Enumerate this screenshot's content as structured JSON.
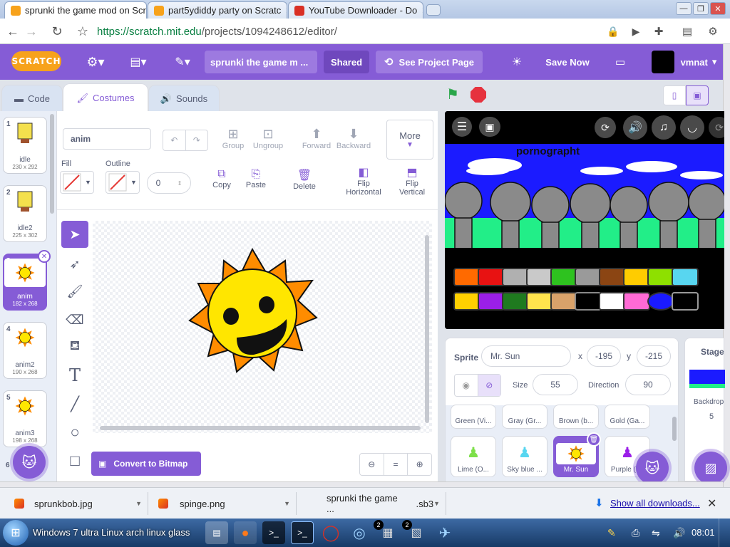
{
  "browser": {
    "tabs": [
      {
        "title": "sprunki the game mod on Scr"
      },
      {
        "title": "part5ydiddy party on Scratc"
      },
      {
        "title": "YouTube Downloader - Do"
      }
    ],
    "url_host": "https://scratch.mit.edu",
    "url_path": "/projects/1094248612/editor/"
  },
  "menubar": {
    "logo": "SCRATCH",
    "project_title": "sprunki the game m ...",
    "shared": "Shared",
    "see_project": "See Project Page",
    "save_now": "Save Now",
    "username": "vmnat"
  },
  "editor_tabs": {
    "code": "Code",
    "costumes": "Costumes",
    "sounds": "Sounds"
  },
  "costumes": [
    {
      "num": "1",
      "name": "idle",
      "size": "230 x 292"
    },
    {
      "num": "2",
      "name": "idle2",
      "size": "225 x 302"
    },
    {
      "num": "3",
      "name": "anim",
      "size": "182 x 268"
    },
    {
      "num": "4",
      "name": "anim2",
      "size": "190 x 268"
    },
    {
      "num": "5",
      "name": "anim3",
      "size": "198 x 268"
    },
    {
      "num": "6"
    }
  ],
  "paint": {
    "costume_name": "anim",
    "group": "Group",
    "ungroup": "Ungroup",
    "forward": "Forward",
    "backward": "Backward",
    "more": "More",
    "fill": "Fill",
    "outline": "Outline",
    "outline_width": "0",
    "copy": "Copy",
    "paste": "Paste",
    "delete": "Delete",
    "flip_h1": "Flip",
    "flip_h2": "Horizontal",
    "flip_v1": "Flip",
    "flip_v2": "Vertical",
    "convert": "Convert to Bitmap",
    "zoom_reset": "="
  },
  "stage": {
    "title_text": "pornographt"
  },
  "sprite_info": {
    "sprite_label": "Sprite",
    "sprite_name": "Mr. Sun",
    "x_label": "x",
    "x": "-195",
    "y_label": "y",
    "y": "-215",
    "size_label": "Size",
    "size": "55",
    "direction_label": "Direction",
    "direction": "90"
  },
  "sprites_row1": [
    "Green (Vi...",
    "Gray (Gr...",
    "Brown (b...",
    "Gold (Ga..."
  ],
  "sprites_row2": [
    "Lime (O...",
    "Sky blue ...",
    "Mr. Sun",
    "Purple (I..."
  ],
  "stage_panel": {
    "label": "Stage",
    "backdrops": "Backdrop",
    "count": "5"
  },
  "downloads": [
    {
      "name": "sprunkbob.jpg"
    },
    {
      "name": "spinge.png"
    },
    {
      "name": "sprunki the game ...",
      "ext": ".sb3"
    }
  ],
  "show_all": "Show all downloads...",
  "taskbar": {
    "start_text": "Windows 7 ultra Linux arch linux glass",
    "badge1": "2",
    "badge2": "2",
    "clock": "08:01"
  },
  "colors": {
    "scratch_purple": "#855cd6",
    "stage_blue": "#1b1bff",
    "sun_yellow": "#ffe600",
    "sun_orange": "#ff8c00"
  }
}
